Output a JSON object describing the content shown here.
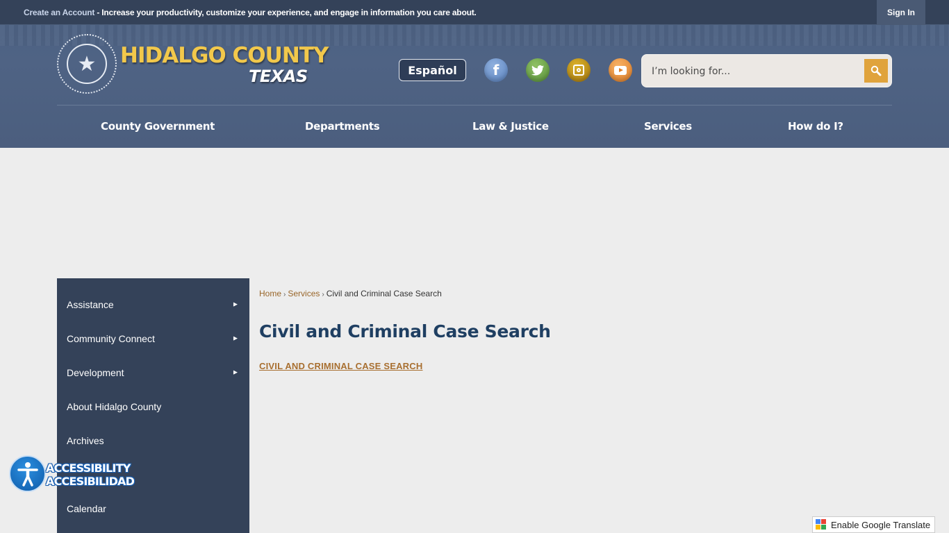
{
  "topbar": {
    "create_account_link": "Create an Account",
    "promo_text": " - Increase your productivity, customize your experience, and engage in information you care about.",
    "sign_in": "Sign In"
  },
  "header": {
    "brand_title": "HIDALGO COUNTY",
    "brand_subtitle": "TEXAS",
    "seal_icon": "county-seal-star",
    "espanol": "Español",
    "social": [
      {
        "name": "facebook",
        "icon": "facebook-icon",
        "glyph": "f"
      },
      {
        "name": "twitter",
        "icon": "twitter-icon",
        "glyph": "🐦"
      },
      {
        "name": "instagram",
        "icon": "instagram-icon"
      },
      {
        "name": "youtube",
        "icon": "youtube-icon"
      }
    ],
    "search": {
      "placeholder": "I’m looking for...",
      "value": ""
    }
  },
  "nav": {
    "items": [
      "County Government",
      "Departments",
      "Law & Justice",
      "Services",
      "How do I?"
    ]
  },
  "sidebar": {
    "items": [
      {
        "label": "Assistance",
        "has_submenu": true
      },
      {
        "label": "Community Connect",
        "has_submenu": true
      },
      {
        "label": "Development",
        "has_submenu": true
      },
      {
        "label": "About Hidalgo County",
        "has_submenu": false
      },
      {
        "label": "Archives",
        "has_submenu": false
      },
      {
        "label": "",
        "has_submenu": false
      },
      {
        "label": "Calendar",
        "has_submenu": false
      }
    ],
    "arrow_glyph": "►"
  },
  "main": {
    "breadcrumb": [
      "Home",
      "Services",
      "Civil and Criminal Case Search"
    ],
    "breadcrumb_sep": "›",
    "title": "Civil and Criminal Case Search",
    "link": "CIVIL AND CRIMINAL CASE SEARCH"
  },
  "accessibility": {
    "line1": "ACCESSIBILITY",
    "line2": "ACCESIBILIDAD"
  },
  "google_translate": {
    "label": "Enable Google Translate"
  },
  "colors": {
    "topbar": "#344259",
    "header": "#4d6283",
    "brand_gold": "#f2c84b",
    "sidebar": "#344259",
    "title": "#1f3f62",
    "link_brown": "#a86f30",
    "search_button": "#e0a33c"
  }
}
